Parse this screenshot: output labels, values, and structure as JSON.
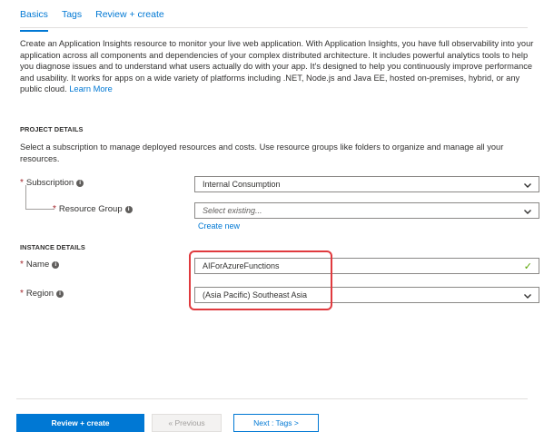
{
  "tabs": [
    {
      "label": "Basics",
      "active": true
    },
    {
      "label": "Tags",
      "active": false
    },
    {
      "label": "Review + create",
      "active": false
    }
  ],
  "intro": {
    "text": "Create an Application Insights resource to monitor your live web application. With Application Insights, you have full observability into your application across all components and dependencies of your complex distributed architecture. It includes powerful analytics tools to help you diagnose issues and to understand what users actually do with your app. It's designed to help you continuously improve performance and usability. It works for apps on a wide variety of platforms including .NET, Node.js and Java EE, hosted on-premises, hybrid, or any public cloud. ",
    "link": "Learn More"
  },
  "project_details": {
    "title": "PROJECT DETAILS",
    "description": "Select a subscription to manage deployed resources and costs. Use resource groups like folders to organize and manage all your resources.",
    "subscription": {
      "label": "Subscription",
      "value": "Internal Consumption"
    },
    "resource_group": {
      "label": "Resource Group",
      "placeholder": "Select existing...",
      "create_new": "Create new"
    }
  },
  "instance_details": {
    "title": "INSTANCE DETAILS",
    "name": {
      "label": "Name",
      "value": "AIForAzureFunctions"
    },
    "region": {
      "label": "Region",
      "value": "(Asia Pacific) Southeast Asia"
    }
  },
  "footer": {
    "review_create": "Review + create",
    "previous": "« Previous",
    "next": "Next : Tags >"
  },
  "colors": {
    "accent": "#0078d4",
    "required": "#a4262c",
    "highlight": "#e03a3e",
    "valid": "#57a300"
  }
}
